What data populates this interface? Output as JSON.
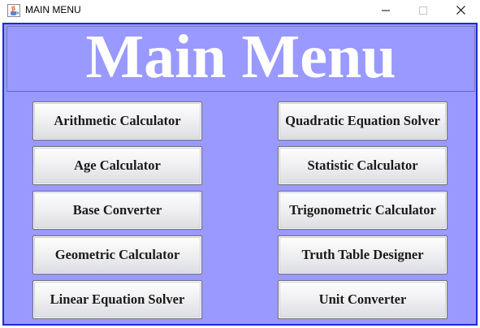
{
  "window": {
    "title": "MAIN MENU",
    "icon": "java-cup-icon",
    "controls": {
      "minimize": "minimize-icon",
      "maximize": "maximize-icon",
      "close": "close-icon"
    }
  },
  "header": {
    "title": "Main Menu"
  },
  "menu": {
    "left": [
      {
        "label": "Arithmetic Calculator"
      },
      {
        "label": "Age Calculator"
      },
      {
        "label": "Base Converter"
      },
      {
        "label": "Geometric Calculator"
      },
      {
        "label": "Linear Equation Solver"
      }
    ],
    "right": [
      {
        "label": "Quadratic Equation Solver"
      },
      {
        "label": "Statistic Calculator"
      },
      {
        "label": "Trigonometric Calculator"
      },
      {
        "label": "Truth Table Designer"
      },
      {
        "label": "Unit Converter"
      }
    ]
  },
  "colors": {
    "background": "#9999ff",
    "border": "#1a2bd4",
    "title_text": "#ffffff"
  }
}
